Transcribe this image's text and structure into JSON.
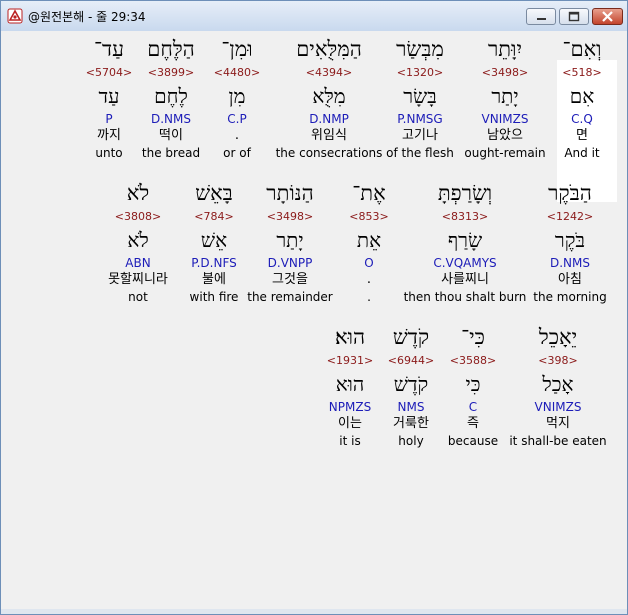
{
  "window": {
    "title": "@원전본해 - 줄 29:34",
    "minimize_icon": "minimize-icon",
    "maximize_icon": "maximize-icon",
    "close_icon": "close-icon",
    "accent": "#c3442c"
  },
  "lines": [
    {
      "words": [
        {
          "heb": "וְאִם־",
          "strong": "<518>",
          "lex": "אִם",
          "morph": "C.Q",
          "kor": "면",
          "eng": "And it"
        },
        {
          "heb": "יִוָּתֵר",
          "strong": "<3498>",
          "lex": "יָתַר",
          "morph": "VNIMZS",
          "kor": "남았으",
          "eng": "ought-remain"
        },
        {
          "heb": "מִבְּשַׂר",
          "strong": "<1320>",
          "lex": "בָּשָׂר",
          "morph": "P.NMSG",
          "kor": "고기나",
          "eng": "of the flesh"
        },
        {
          "heb": "הַמִּלֻּאִים",
          "strong": "<4394>",
          "lex": "מִלֻּא",
          "morph": "D.NMP",
          "kor": "위임식",
          "eng": "the consecrations"
        },
        {
          "heb": "וּמִן־",
          "strong": "<4480>",
          "lex": "מִן",
          "morph": "C.P",
          "kor": ".",
          "eng": "or of"
        },
        {
          "heb": "הַלֶּחֶם",
          "strong": "<3899>",
          "lex": "לֶחֶם",
          "morph": "D.NMS",
          "kor": "떡이",
          "eng": "the bread"
        },
        {
          "heb": "עַד־",
          "strong": "<5704>",
          "lex": "עַד",
          "morph": "P",
          "kor": "까지",
          "eng": "unto"
        }
      ]
    },
    {
      "words": [
        {
          "heb": "הַבֹּקֶר",
          "strong": "<1242>",
          "lex": "בֹּקֶר",
          "morph": "D.NMS",
          "kor": "아침",
          "eng": "the morning"
        },
        {
          "heb": "וְשָׂרַפְתָּ",
          "strong": "<8313>",
          "lex": "שָׂרַף",
          "morph": "C.VQAMYS",
          "kor": "사를찌니",
          "eng": "then thou shalt burn"
        },
        {
          "heb": "אֶת־",
          "strong": "<853>",
          "lex": "אֵת",
          "morph": "O",
          "kor": ".",
          "eng": "."
        },
        {
          "heb": "הַנּוֹתָר",
          "strong": "<3498>",
          "lex": "יָתַר",
          "morph": "D.VNPP",
          "kor": "그것을",
          "eng": "the remainder"
        },
        {
          "heb": "בָּאֵשׁ",
          "strong": "<784>",
          "lex": "אֵשׁ",
          "morph": "P.D.NFS",
          "kor": "불에",
          "eng": "with fire"
        },
        {
          "heb": "לֹא",
          "strong": "<3808>",
          "lex": "לֹא",
          "morph": "ABN",
          "kor": "못할찌니라",
          "eng": "not"
        }
      ]
    },
    {
      "words": [
        {
          "heb": "יֵאָכֵל",
          "strong": "<398>",
          "lex": "אָכַל",
          "morph": "VNIMZS",
          "kor": "먹지",
          "eng": "it shall-be eaten"
        },
        {
          "heb": "כִּי־",
          "strong": "<3588>",
          "lex": "כִּי",
          "morph": "C",
          "kor": "즉",
          "eng": "because"
        },
        {
          "heb": "קֹדֶשׁ",
          "strong": "<6944>",
          "lex": "קֹדֶשׁ",
          "morph": "NMS",
          "kor": "거룩한",
          "eng": "holy"
        },
        {
          "heb": "הוּא׃",
          "strong": "<1931>",
          "lex": "הוּא",
          "morph": "NPMZS",
          "kor": "이는",
          "eng": "it is"
        }
      ]
    }
  ]
}
